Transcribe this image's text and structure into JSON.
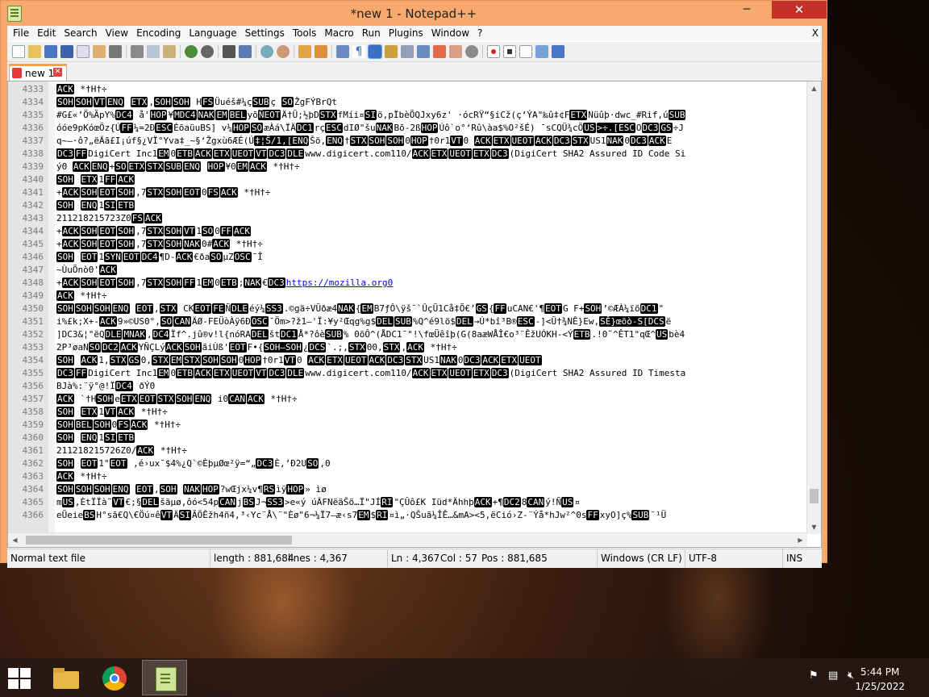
{
  "window": {
    "title": "*new 1 - Notepad++",
    "minimize": "─",
    "maximize": "□",
    "close": "✕"
  },
  "menu": {
    "items": [
      "File",
      "Edit",
      "Search",
      "View",
      "Encoding",
      "Language",
      "Settings",
      "Tools",
      "Macro",
      "Run",
      "Plugins",
      "Window",
      "?"
    ],
    "close": "X"
  },
  "tab": {
    "label": "new 1",
    "close": "✕"
  },
  "editor": {
    "lines": [
      {
        "n": "4333",
        "code": "[ACK] *†H†÷"
      },
      {
        "n": "4334",
        "code": "[SOH][SOH][VT][ENQ] [ETX],[SOH][SOH] H[FS]Üuéš#¼ç[SUB]ç [SO]ŽgFÝBrQt"
      },
      {
        "n": "4335",
        "code": "#G£«’Ö%ÃpY%[DC4] å'[HOP]¥[MDC4][NAK][EM][BEL]yõ[ÑEOT]Ä†Ü;½þD[STX]fMíi¤[SI]ö,pÏbèÕQJxy6z' ·ócRŸ“§iCž(ç‘ÝA\"‰û‡¢F[ETX]Nüûþ·dwc_#Rif,ú[SUB]"
      },
      {
        "n": "4336",
        "code": "óóe9pKóœÖz{Ú[FF]¼=2Ð[ESC]ÉõaüuBS] v¼[HOP][SO]æÀá\\ÏÄ[DC1]rç[ESC]dIØ\"šu[NAK]Bõ-2ß[HOP]Úô`o°‘Rû\\àa$%O²šÉ) ¯sCQÜ¾cÖ[US][>÷.[ESC]O[DC3][GS]÷J"
      },
      {
        "n": "4337",
        "code": "q~—·ô?„ëÄã£I¡úf§¿VÏ°Yva‡_~§‘Žgxù6ÆÉ(Ú[‡¦Š/1,[ENQ]Šö,[ENQ]†[STX][SOH][SOH]0[HOP]†0r1[VT]0    [ACK][ETX][UEOT][ACK][DC3][STX]US1[NAK]0[DC3][ACK]E"
      },
      {
        "n": "4338",
        "code": "[DC3][FF]DigiCert Inc1[EM]0[ETB][ACK][ETX][UEOT][VT][DC3][DLE]www.digicert.com110/[ACK][ETX][UEOT][ETX][DC3](DigiCert SHA2 Assured ID Code Si"
      },
      {
        "n": "4339",
        "code": "ý0  [ACK][ENQ]+[SO][ETX][STX][SUB][ENQ]  [HOP]¥0[EM][ACK]   *†H†÷"
      },
      {
        "n": "4340",
        "code": "[SOH] [ETX]1[FF][ACK]"
      },
      {
        "n": "4341",
        "code": "+[ACK][SOH][EOT][SOH],7[STX][SOH][EOT]0[FS][ACK]   *†H†÷"
      },
      {
        "n": "4342",
        "code": "[SOH] [ENQ]1[SI][ETB]"
      },
      {
        "n": "4343",
        "code": "211218215723Z0[FS][ACK]"
      },
      {
        "n": "4344",
        "code": "+[ACK][SOH][EOT][SOH],7[STX][SOH][VT]1[SO]0[FF][ACK]"
      },
      {
        "n": "4345",
        "code": "+[ACK][SOH][EOT][SOH],7[STX][SOH][NAK]0#[ACK]    *†H†÷"
      },
      {
        "n": "4346",
        "code": "[SOH] [EOT]1[SYN][EOT][DC4]¶D-[ACK]€ðа[SO]µZ[OSC]¯Î"
      },
      {
        "n": "4347",
        "code": "~ÙuÕnò0'[ACK]"
      },
      {
        "n": "4348",
        "code": "+[ACK][SOH][EOT][SOH],7[STX][SOH][FF]1[EM]0[ETB];[NAK]€[DC3]{https://mozilla.org0}"
      },
      {
        "n": "4349",
        "code": "[ACK] *†H†÷"
      },
      {
        "n": "4350",
        "code": "[SOH][SOH][SOH][ENQ] [EOT],[STX] CK[EOT][FE]Ñ[DLE]éý¼[SS3].©gä÷VÜðæ4[NAK]{[EM]B7ƒÔ\\ÿš¨`ÛçÜ1Cå‡Õ€’[GS]{[FF]uCAN€'¶[EOT]G     F+[SOH]’©ÆÀ¼ïõ[DC1]\""
      },
      {
        "n": "4351",
        "code": "i%£k;X+-[ACK]9»©US0°,[SO][CAN]ÄØ-FEÜòÀÿ6Ð[OSC]¯Öm>?ž1—'Ï:¥y²Œqg%g$[DEL][SUB]%Q^é9lö$[DEL]→Ú*bî³B®[ESC]-]<Ü†¾NÊ}Ew,[SÊ}œõò-S[DCS]ë"
      },
      {
        "n": "4352",
        "code": "]DC3&¦\"ëQ[DLE][MNAK],[DC4]Ïf^.jû®v!l{nóRA[DEL]št[DC1]Å*?ôè[SUB]% 0õÔ^(ÅDC1¯\"!\\fœÜêîþ(G(8aæWÅÎ€o³¨ÊžUÓKH-<Ý[ETB].!0˜^ÊT1\"qŒ^[US]bè4"
      },
      {
        "n": "4353",
        "code": "2P³øaN[SO][DC2][ACK]YÑÇLý[ACK][SOH]ãiÙß'[EOT]F•{[SOH—SOH]¿[DCS]`.;,[STX]00,[STX],[ACK]    *†H†÷"
      },
      {
        "n": "4354",
        "code": "[SOH] [ACK]1,[STX][GS]0,[STX][EM][STX][SOH][SOH]0[HOP]†0r1[VT]0    [ACK][ETX][UEOT][ACK][DC3][STX]US1[NAK]0[DC3][ACK][ETX][UEOT]"
      },
      {
        "n": "4355",
        "code": "[DC3][FF]DigiCert Inc1[EM]0[ETB][ACK][ETX][UEOT][VT][DC3][DLE]www.digicert.com110/[ACK][ETX][UEOT][ETX][DC3](DigiCert SHA2 Assured ID Timesta"
      },
      {
        "n": "4356",
        "code": "BJà%:¨ÿ°@!Ï[DC4] ðÝ0"
      },
      {
        "n": "4357",
        "code": "[ACK] `†H[SOH]e[ETX][EOT][STX][SOH][ENQ]  i0[CAN][ACK] *†H†÷"
      },
      {
        "n": "4358",
        "code": "[SOH] [ETX]1[VT][ACK]  *†H†÷"
      },
      {
        "n": "4359",
        "code": "[SOH][BEL][SOH]0[FS][ACK]   *†H†÷"
      },
      {
        "n": "4360",
        "code": "[SOH] [ENQ]1[SI][ETB]"
      },
      {
        "n": "4361",
        "code": "211218215726Z0/[ACK]  *†H†÷"
      },
      {
        "n": "4362",
        "code": "[SOH] [EOT]1\"[EOT] ,é›ux¯$4%¿Q`©ÈþµØœ²ÿ=“„[DC3]È,’Ð2U[SO],0"
      },
      {
        "n": "4363",
        "code": "[ACK] *†H†÷"
      },
      {
        "n": "4364",
        "code": "[SOH][SOH][SOH][ENQ] [EOT],[SOH] [NAK][HOP]?wŒjx¼v¶[RS]ìÿ[HOP]» ìø"
      },
      {
        "n": "4365",
        "code": "m[US],ÈtÏÏà˜[VT]€;§[DEL]šäµø,ôó<54p[CAN]j[BS]J¬[SS3]>e«ý úÄFNëäŠö…Ï\"JÍ[RI]\"ÇÛô£K   Iüd*Ähhþ[ACK]+¶[DC2]8[CAN]ý!Ñ[US]¤"
      },
      {
        "n": "4366",
        "code": "eÜeie[BS]H°sã€Q\\€Öú¤ê[VT]Ä[SI]ÃÖÊžh4ñ4,³‹Yc¨Å\\¨\"Èø\"6¬¼Ï7–æ‹s7[EM]$[RI]¤ì„·QŠuã¼ÎÊ…&mA><5,ëCió›Z-¨Ýå*hJw²^0s[FF]xyO]ç%[SUB]¨¹Ü"
      }
    ]
  },
  "status": {
    "type": "Normal text file",
    "length": "length : 881,684",
    "lines": "lines : 4,367",
    "ln": "Ln : 4,367",
    "col": "Col : 57",
    "pos": "Pos : 881,685",
    "eol": "Windows (CR LF)",
    "encoding": "UTF-8",
    "mode": "INS"
  },
  "taskbar": {
    "time": "5:44 PM",
    "date": "1/25/2022"
  },
  "colors": {
    "titlebar": "#f8a96d",
    "close": "#c7302a",
    "tab_accent": "#f9a23c"
  }
}
